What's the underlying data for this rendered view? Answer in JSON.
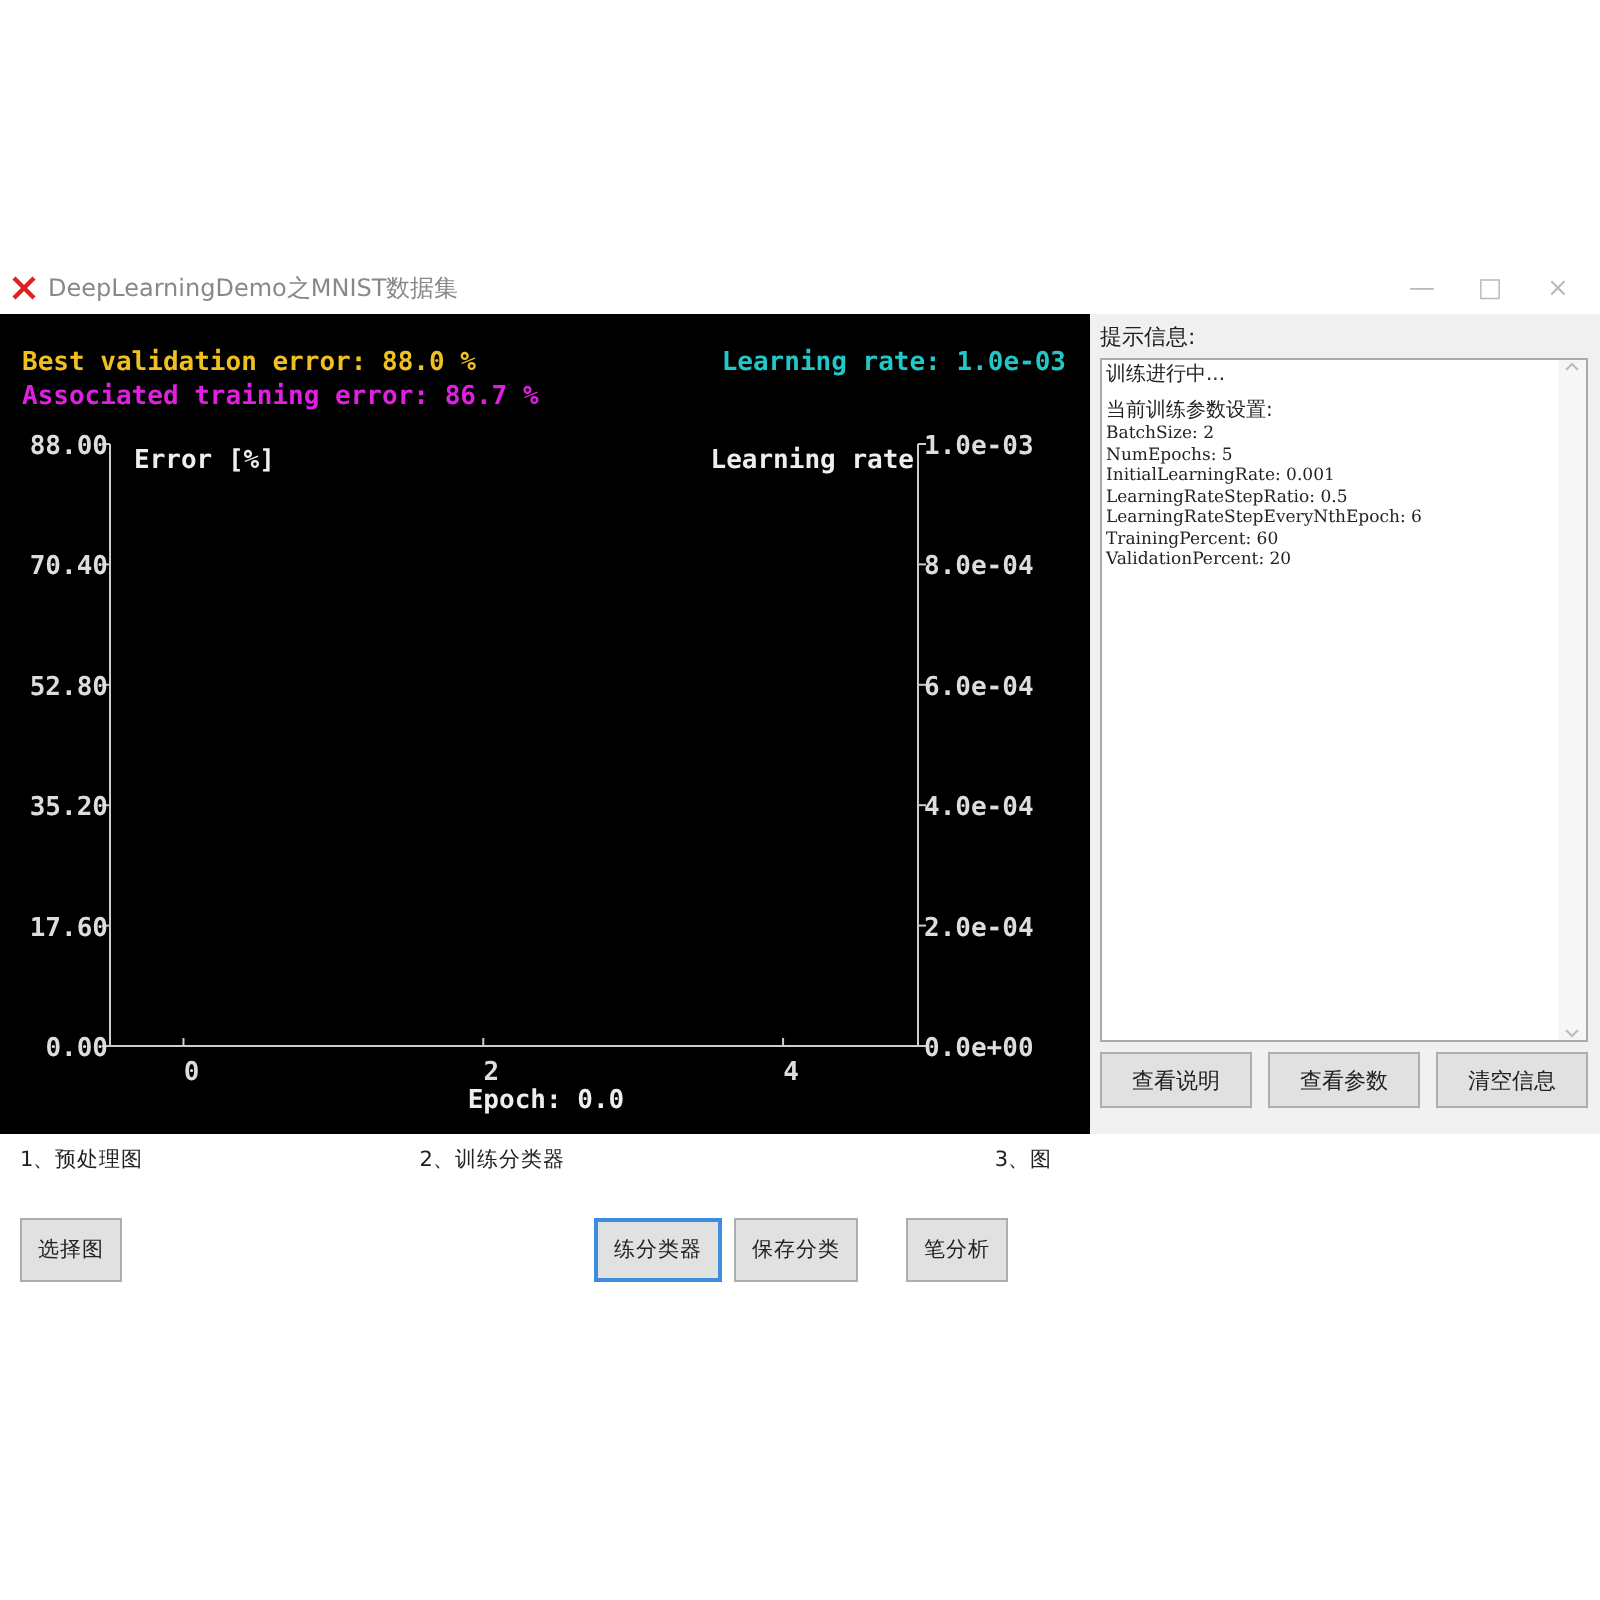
{
  "window": {
    "title": "DeepLearningDemo之MNIST数据集",
    "controls": [
      "—",
      "□",
      "×"
    ]
  },
  "chart_panel": {
    "header_left": [
      {
        "text": "Best validation error: 88.0 %",
        "color": "#f0c020"
      },
      {
        "text": "Associated training error: 86.7 %",
        "color": "#e020e0"
      }
    ],
    "header_right": {
      "text": "Learning rate: 1.0e-03",
      "color": "#20c8c8"
    },
    "right_axis_title": "Learning rate",
    "xlabel": "Epoch: 0.0",
    "right_ticks": [
      "1.0e-03",
      "8.0e-04",
      "6.0e-04",
      "4.0e-04",
      "2.0e-04",
      "0.0e+00"
    ],
    "chart_data": {
      "type": "line",
      "ylabel": "Error [%]",
      "xlim": [
        -0.49,
        4.9
      ],
      "ylim": [
        0,
        88
      ],
      "xticks": [
        0,
        2,
        4
      ],
      "yticks": [
        {
          "value": 88,
          "label": "88.00"
        },
        {
          "value": 70.4,
          "label": "70.40"
        },
        {
          "value": 52.8,
          "label": "52.80"
        },
        {
          "value": 35.2,
          "label": "35.20"
        },
        {
          "value": 17.6,
          "label": "17.60"
        },
        {
          "value": 0,
          "label": "0.00"
        }
      ]
    }
  },
  "info_panel": {
    "label": "提示信息:",
    "lines": [
      "训练进行中...",
      "当前训练参数设置:",
      "BatchSize: 2",
      "NumEpochs: 5",
      "InitialLearningRate: 0.001",
      "LearningRateStepRatio: 0.5",
      "LearningRateStepEveryNthEpoch: 6",
      "TrainingPercent: 60",
      "ValidationPercent: 20"
    ],
    "buttons": [
      "查看说明",
      "查看参数",
      "清空信息"
    ]
  },
  "bottom": {
    "sections": [
      "1、预处理图",
      "2、训练分类器",
      "3、图"
    ],
    "buttons": [
      {
        "label": "选择图",
        "focused": false
      },
      {
        "label": "练分类器",
        "focused": true
      },
      {
        "label": "保存分类",
        "focused": false
      },
      {
        "label": "笔分析",
        "focused": false
      }
    ]
  }
}
